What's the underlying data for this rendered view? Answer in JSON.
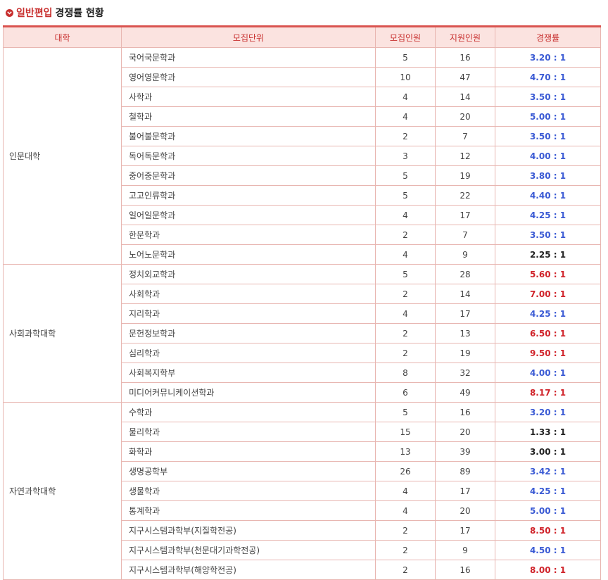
{
  "header": {
    "accent": "일반편입",
    "rest": "경쟁률 현황"
  },
  "colors": {
    "accent": "#c8302f",
    "blue": "#3a5ad4",
    "red": "#d0232a",
    "black": "#222222",
    "header_bg": "#fbe3e0",
    "border": "#e8b6b1"
  },
  "table": {
    "columns": [
      "대학",
      "모집단위",
      "모집인원",
      "지원인원",
      "경쟁률"
    ],
    "groups": [
      {
        "college": "인문대학",
        "rows": [
          {
            "unit": "국어국문학과",
            "quota": "5",
            "applicants": "16",
            "ratio": "3.20 : 1",
            "tone": "blue"
          },
          {
            "unit": "영어영문학과",
            "quota": "10",
            "applicants": "47",
            "ratio": "4.70 : 1",
            "tone": "blue"
          },
          {
            "unit": "사학과",
            "quota": "4",
            "applicants": "14",
            "ratio": "3.50 : 1",
            "tone": "blue"
          },
          {
            "unit": "철학과",
            "quota": "4",
            "applicants": "20",
            "ratio": "5.00 : 1",
            "tone": "blue"
          },
          {
            "unit": "불어불문학과",
            "quota": "2",
            "applicants": "7",
            "ratio": "3.50 : 1",
            "tone": "blue"
          },
          {
            "unit": "독어독문학과",
            "quota": "3",
            "applicants": "12",
            "ratio": "4.00 : 1",
            "tone": "blue"
          },
          {
            "unit": "중어중문학과",
            "quota": "5",
            "applicants": "19",
            "ratio": "3.80 : 1",
            "tone": "blue"
          },
          {
            "unit": "고고인류학과",
            "quota": "5",
            "applicants": "22",
            "ratio": "4.40 : 1",
            "tone": "blue"
          },
          {
            "unit": "일어일문학과",
            "quota": "4",
            "applicants": "17",
            "ratio": "4.25 : 1",
            "tone": "blue"
          },
          {
            "unit": "한문학과",
            "quota": "2",
            "applicants": "7",
            "ratio": "3.50 : 1",
            "tone": "blue"
          },
          {
            "unit": "노어노문학과",
            "quota": "4",
            "applicants": "9",
            "ratio": "2.25 : 1",
            "tone": "black"
          }
        ]
      },
      {
        "college": "사회과학대학",
        "rows": [
          {
            "unit": "정치외교학과",
            "quota": "5",
            "applicants": "28",
            "ratio": "5.60 : 1",
            "tone": "red"
          },
          {
            "unit": "사회학과",
            "quota": "2",
            "applicants": "14",
            "ratio": "7.00 : 1",
            "tone": "red"
          },
          {
            "unit": "지리학과",
            "quota": "4",
            "applicants": "17",
            "ratio": "4.25 : 1",
            "tone": "blue"
          },
          {
            "unit": "문헌정보학과",
            "quota": "2",
            "applicants": "13",
            "ratio": "6.50 : 1",
            "tone": "red"
          },
          {
            "unit": "심리학과",
            "quota": "2",
            "applicants": "19",
            "ratio": "9.50 : 1",
            "tone": "red"
          },
          {
            "unit": "사회복지학부",
            "quota": "8",
            "applicants": "32",
            "ratio": "4.00 : 1",
            "tone": "blue"
          },
          {
            "unit": "미디어커뮤니케이션학과",
            "quota": "6",
            "applicants": "49",
            "ratio": "8.17 : 1",
            "tone": "red"
          }
        ]
      },
      {
        "college": "자연과학대학",
        "rows": [
          {
            "unit": "수학과",
            "quota": "5",
            "applicants": "16",
            "ratio": "3.20 : 1",
            "tone": "blue"
          },
          {
            "unit": "물리학과",
            "quota": "15",
            "applicants": "20",
            "ratio": "1.33 : 1",
            "tone": "black"
          },
          {
            "unit": "화학과",
            "quota": "13",
            "applicants": "39",
            "ratio": "3.00 : 1",
            "tone": "black"
          },
          {
            "unit": "생명공학부",
            "quota": "26",
            "applicants": "89",
            "ratio": "3.42 : 1",
            "tone": "blue"
          },
          {
            "unit": "생물학과",
            "quota": "4",
            "applicants": "17",
            "ratio": "4.25 : 1",
            "tone": "blue"
          },
          {
            "unit": "통계학과",
            "quota": "4",
            "applicants": "20",
            "ratio": "5.00 : 1",
            "tone": "blue"
          },
          {
            "unit": "지구시스템과학부(지질학전공)",
            "quota": "2",
            "applicants": "17",
            "ratio": "8.50 : 1",
            "tone": "red"
          },
          {
            "unit": "지구시스템과학부(천문대기과학전공)",
            "quota": "2",
            "applicants": "9",
            "ratio": "4.50 : 1",
            "tone": "blue"
          },
          {
            "unit": "지구시스템과학부(해양학전공)",
            "quota": "2",
            "applicants": "16",
            "ratio": "8.00 : 1",
            "tone": "red"
          }
        ]
      }
    ]
  }
}
